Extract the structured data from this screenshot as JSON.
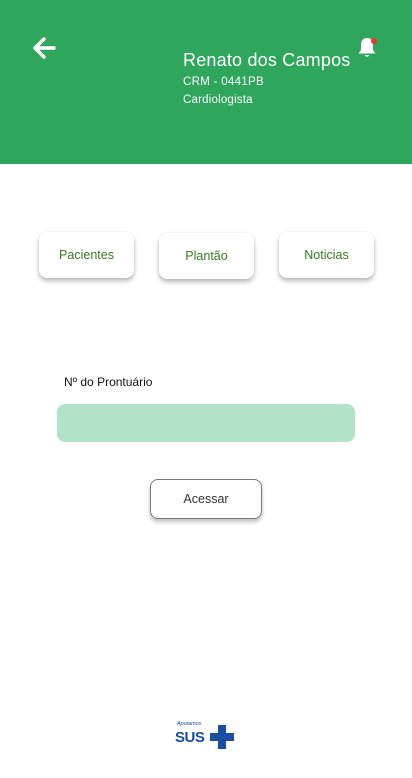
{
  "header": {
    "user_name": "Renato dos Campos",
    "crm": "CRM - 0441PB",
    "specialty": "Cardiologista",
    "back_icon": "arrow-left-icon",
    "bell_icon": "bell-icon",
    "notification_dot_color": "#e53935"
  },
  "tabs": [
    {
      "label": "Pacientes"
    },
    {
      "label": "Plantão"
    },
    {
      "label": "Noticias"
    }
  ],
  "form": {
    "label": "Nº do Prontuário",
    "value": "",
    "placeholder": "",
    "submit_label": "Acessar"
  },
  "footer": {
    "logo_tagline": "Apoiamos",
    "logo_text": "SUS"
  },
  "colors": {
    "header_bg": "#2ea75c",
    "input_bg": "#b3e3c6",
    "tab_text": "#3a7a22",
    "sus_blue": "#1b4ea0"
  }
}
